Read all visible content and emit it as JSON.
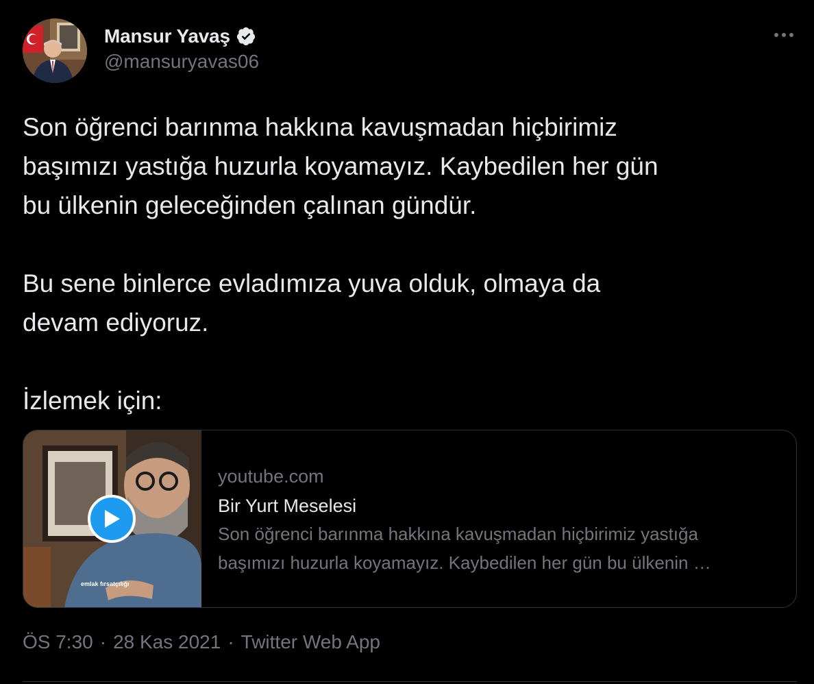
{
  "author": {
    "display_name": "Mansur Yavaş",
    "handle": "@mansuryavas06",
    "verified": true,
    "avatar_icon": "profile-photo"
  },
  "more_icon": "ellipsis-icon",
  "tweet": {
    "paragraphs": [
      "Son öğrenci barınma hakkına kavuşmadan hiçbirimiz\nbaşımızı yastığa huzurla koyamayız. Kaybedilen her gün\nbu ülkenin geleceğinden çalınan gündür.",
      "Bu sene binlerce evladımıza yuva olduk, olmaya da\ndevam ediyoruz.",
      "İzlemek için:"
    ]
  },
  "card": {
    "domain": "youtube.com",
    "title": "Bir Yurt Meselesi",
    "description": "Son öğrenci barınma hakkına kavuşmadan hiçbirimiz yastığa\nbaşımızı huzurla koyamayız. Kaybedilen her gün bu ülkenin …",
    "thumbnail_caption": "emlak fırsatçılığı",
    "play_icon": "play-icon"
  },
  "meta": {
    "time": "ÖS 7:30",
    "date": "28 Kas 2021",
    "source": "Twitter Web App",
    "separator": "·"
  },
  "colors": {
    "background": "#000000",
    "text_primary": "#e7e9ea",
    "text_secondary": "#71767b",
    "accent": "#1d9bf0",
    "border": "#2f3336"
  }
}
